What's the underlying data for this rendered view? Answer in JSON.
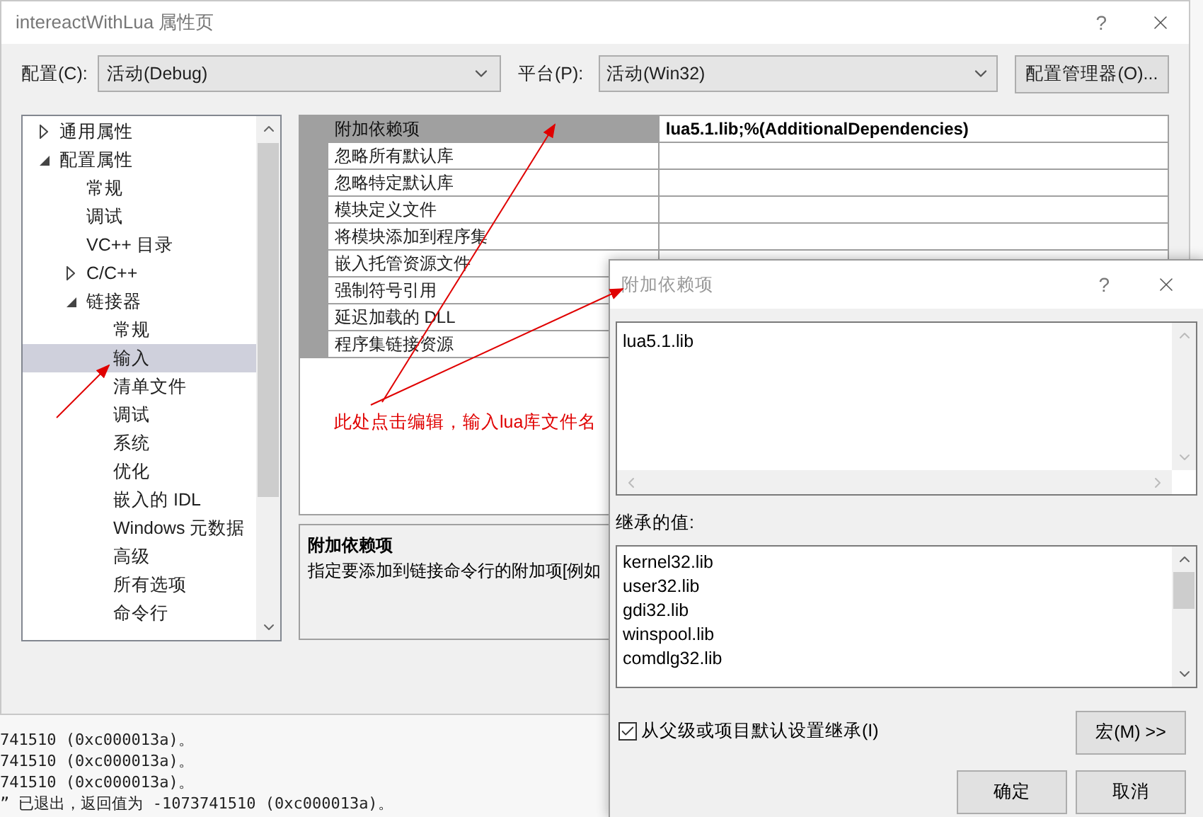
{
  "main_window": {
    "title": "intereactWithLua 属性页",
    "help": "?"
  },
  "toolbar": {
    "config_label": "配置(C):",
    "config_value": "活动(Debug)",
    "platform_label": "平台(P):",
    "platform_value": "活动(Win32)",
    "manager_button": "配置管理器(O)..."
  },
  "tree": [
    {
      "label": "通用属性",
      "kind": "group",
      "expanded": false,
      "selected": false
    },
    {
      "label": "配置属性",
      "kind": "group",
      "expanded": true,
      "selected": false,
      "children": [
        {
          "label": "常规",
          "kind": "leaf",
          "selected": false
        },
        {
          "label": "调试",
          "kind": "leaf",
          "selected": false
        },
        {
          "label": "VC++ 目录",
          "kind": "leaf",
          "selected": false
        },
        {
          "label": "C/C++",
          "kind": "group",
          "expanded": false,
          "selected": false
        },
        {
          "label": "链接器",
          "kind": "group",
          "expanded": true,
          "selected": false,
          "children": [
            {
              "label": "常规",
              "kind": "leaf",
              "selected": false
            },
            {
              "label": "输入",
              "kind": "leaf",
              "selected": true
            },
            {
              "label": "清单文件",
              "kind": "leaf",
              "selected": false
            },
            {
              "label": "调试",
              "kind": "leaf",
              "selected": false
            },
            {
              "label": "系统",
              "kind": "leaf",
              "selected": false
            },
            {
              "label": "优化",
              "kind": "leaf",
              "selected": false
            },
            {
              "label": "嵌入的 IDL",
              "kind": "leaf",
              "selected": false
            },
            {
              "label": "Windows 元数据",
              "kind": "leaf",
              "selected": false
            },
            {
              "label": "高级",
              "kind": "leaf",
              "selected": false
            },
            {
              "label": "所有选项",
              "kind": "leaf",
              "selected": false
            },
            {
              "label": "命令行",
              "kind": "leaf",
              "selected": false
            }
          ]
        }
      ]
    }
  ],
  "properties": [
    {
      "name": "附加依赖项",
      "value": "lua5.1.lib;%(AdditionalDependencies)",
      "selected": true
    },
    {
      "name": "忽略所有默认库",
      "selected": false
    },
    {
      "name": "忽略特定默认库",
      "selected": false
    },
    {
      "name": "模块定义文件",
      "selected": false
    },
    {
      "name": "将模块添加到程序集",
      "selected": false
    },
    {
      "name": "嵌入托管资源文件",
      "selected": false
    },
    {
      "name": "强制符号引用",
      "selected": false
    },
    {
      "name": "延迟加载的 DLL",
      "selected": false
    },
    {
      "name": "程序集链接资源",
      "selected": false
    }
  ],
  "description": {
    "title": "附加依赖项",
    "text": "指定要添加到链接命令行的附加项[例如"
  },
  "annotation": {
    "text": "此处点击编辑，输入lua库文件名"
  },
  "console_lines": [
    "741510 (0xc000013a)。",
    "741510 (0xc000013a)。",
    "741510 (0xc000013a)。",
    "” 已退出，返回值为 -1073741510 (0xc000013a)。"
  ],
  "dialog": {
    "title": "附加依赖项",
    "help": "?",
    "value": "lua5.1.lib",
    "inherited_label": "继承的值:",
    "inherited": [
      "kernel32.lib",
      "user32.lib",
      "gdi32.lib",
      "winspool.lib",
      "comdlg32.lib"
    ],
    "inherit_checkbox": {
      "label": "从父级或项目默认设置继承(I)",
      "checked": true
    },
    "macro_button": "宏(M) >>",
    "ok_button": "确定",
    "cancel_button": "取消"
  }
}
